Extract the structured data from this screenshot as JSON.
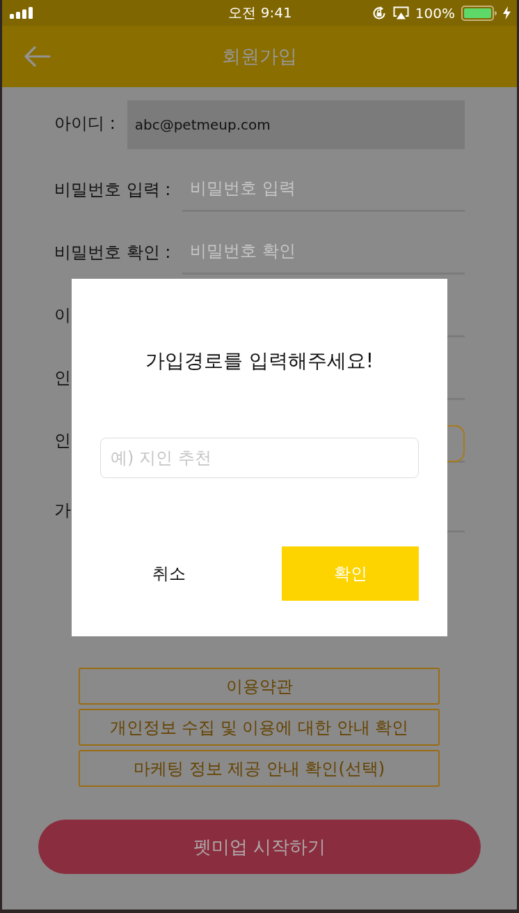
{
  "status_bar": {
    "time": "오전 9:41",
    "battery": "100%"
  },
  "header": {
    "title": "회원가입"
  },
  "form": {
    "rows": [
      {
        "kind": "filled",
        "label": "아이디 :",
        "value": "abc@petmeup.com"
      },
      {
        "kind": "underline",
        "label": "비밀번호 입력 :",
        "placeholder": "비밀번호 입력"
      },
      {
        "kind": "underline",
        "label": "비밀번호 확인 :",
        "placeholder": "비밀번호 확인"
      },
      {
        "kind": "underline",
        "label": "이"
      },
      {
        "kind": "underline",
        "label": "인"
      },
      {
        "kind": "button",
        "label": "인"
      },
      {
        "kind": "underline",
        "label": "가"
      }
    ]
  },
  "agreements": [
    "이용약관",
    "개인정보 수집 및 이용에 대한 안내 확인",
    "마케팅 정보 제공 안내 확인(선택)"
  ],
  "start_button": "펫미업 시작하기",
  "dialog": {
    "title": "가입경로를 입력해주세요!",
    "input": {
      "placeholder": "예) 지인 추천"
    },
    "buttons": [
      {
        "kind": "text",
        "label": "취소"
      },
      {
        "kind": "primary",
        "label": "확인"
      }
    ]
  }
}
